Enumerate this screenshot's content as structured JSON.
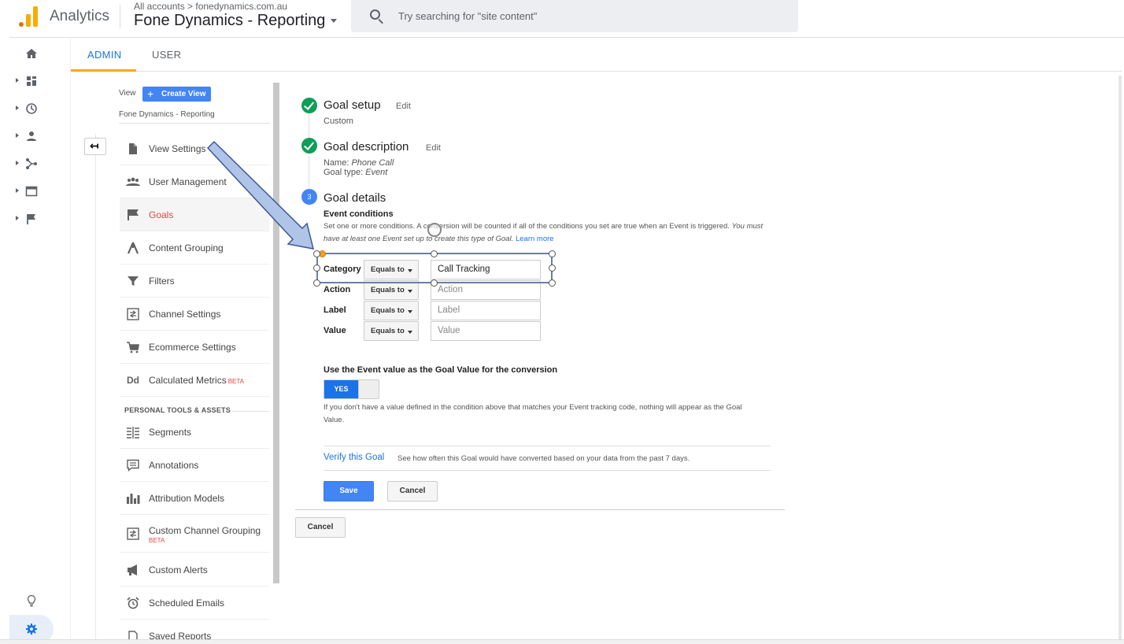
{
  "header": {
    "app_title": "Analytics",
    "breadcrumb": "All accounts > fonedynamics.com.au",
    "account_name": "Fone Dynamics - Reporting",
    "search_placeholder": "Try searching for \"site content\""
  },
  "rail": {
    "icons": [
      "home-icon",
      "customization-icon",
      "realtime-icon",
      "audience-icon",
      "acquisition-icon",
      "behavior-icon",
      "conversions-icon",
      "lightbulb-icon",
      "admin-gear-icon"
    ]
  },
  "tabs": {
    "admin": "ADMIN",
    "user": "USER"
  },
  "view_column": {
    "view_label": "View",
    "create_view": "Create View",
    "view_name": "Fone Dynamics - Reporting",
    "items": [
      {
        "label": "View Settings",
        "icon": "document-icon"
      },
      {
        "label": "User Management",
        "icon": "people-icon"
      },
      {
        "label": "Goals",
        "icon": "flag-icon",
        "active": true
      },
      {
        "label": "Content Grouping",
        "icon": "content-grouping-icon"
      },
      {
        "label": "Filters",
        "icon": "filter-icon"
      },
      {
        "label": "Channel Settings",
        "icon": "channel-icon"
      },
      {
        "label": "Ecommerce Settings",
        "icon": "cart-icon"
      },
      {
        "label": "Calculated Metrics",
        "icon": "dd-icon",
        "badge": "BETA"
      }
    ],
    "section_title": "PERSONAL TOOLS & ASSETS",
    "personal_items": [
      {
        "label": "Segments",
        "icon": "segments-icon"
      },
      {
        "label": "Annotations",
        "icon": "annotation-icon"
      },
      {
        "label": "Attribution Models",
        "icon": "bar-chart-icon"
      },
      {
        "label": "Custom Channel Grouping",
        "icon": "channel-grouping-icon",
        "badge": "BETA"
      },
      {
        "label": "Custom Alerts",
        "icon": "megaphone-icon"
      },
      {
        "label": "Scheduled Emails",
        "icon": "alarm-icon"
      },
      {
        "label": "Saved Reports",
        "icon": "saved-reports-icon"
      }
    ]
  },
  "goal": {
    "setup": {
      "title": "Goal setup",
      "edit": "Edit",
      "value": "Custom"
    },
    "description": {
      "title": "Goal description",
      "edit": "Edit",
      "name_label": "Name:",
      "name_value": "Phone Call",
      "type_label": "Goal type:",
      "type_value": "Event"
    },
    "details": {
      "step_number": "3",
      "title": "Goal details",
      "conditions_title": "Event conditions",
      "conditions_desc": "Set one or more conditions. A conversion will be counted if all of the conditions you set are true when an Event is triggered.",
      "conditions_desc_italic": "You must have at least one Event set up to create this type of Goal.",
      "learn_more": "Learn more",
      "conditions": [
        {
          "label": "Category",
          "operator": "Equals to",
          "value": "Call Tracking",
          "placeholder": ""
        },
        {
          "label": "Action",
          "operator": "Equals to",
          "value": "",
          "placeholder": "Action"
        },
        {
          "label": "Label",
          "operator": "Equals to",
          "value": "",
          "placeholder": "Label"
        },
        {
          "label": "Value",
          "operator": "Equals to",
          "value": "",
          "placeholder": "Value"
        }
      ],
      "use_value_title": "Use the Event value as the Goal Value for the conversion",
      "toggle_label": "YES",
      "use_value_desc": "If you don't have a value defined in the condition above that matches your Event tracking code, nothing will appear as the Goal Value.",
      "verify_link": "Verify this Goal",
      "verify_desc": "See how often this Goal would have converted based on your data from the past 7 days.",
      "save": "Save",
      "cancel": "Cancel"
    },
    "cancel_outer": "Cancel"
  },
  "colors": {
    "accent": "#4285f4",
    "active_nav": "#e8453c",
    "success": "#0f9d58",
    "tab_underline": "#f9ab00"
  }
}
